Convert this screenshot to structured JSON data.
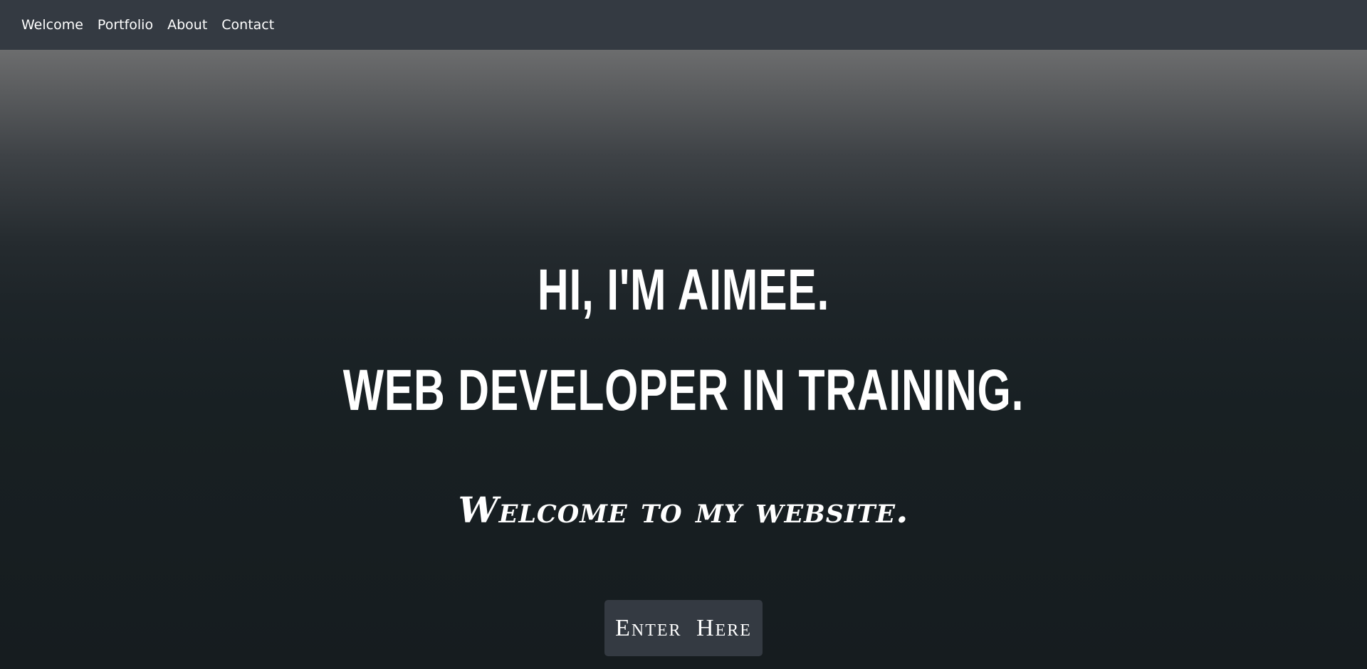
{
  "nav": {
    "items": [
      {
        "label": "Welcome"
      },
      {
        "label": "Portfolio"
      },
      {
        "label": "About"
      },
      {
        "label": "Contact"
      }
    ]
  },
  "hero": {
    "headline_line1": "HI, I'M AIMEE.",
    "headline_line2": "WEB DEVELOPER IN TRAINING.",
    "tagline": "Welcome to my website.",
    "button_label": "Enter Here"
  },
  "colors": {
    "navbar_bg": "#343a42",
    "hero_bg_top": "#6c6d6e",
    "hero_bg_bottom": "#161c1f",
    "text": "#ffffff",
    "button_bg": "#343a42"
  }
}
